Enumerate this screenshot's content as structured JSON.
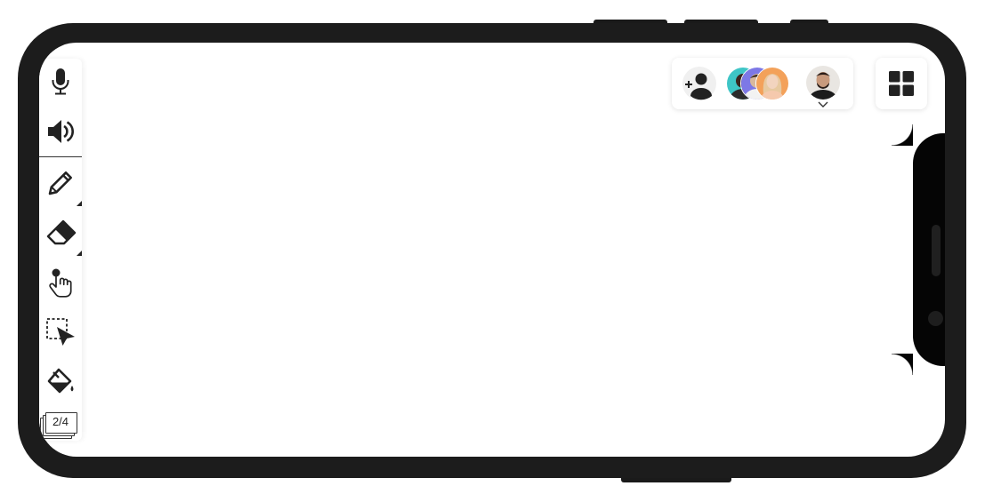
{
  "device": {
    "frame_color": "#1c1c1c",
    "screen_color": "#ffffff"
  },
  "toolbar": {
    "tools": [
      {
        "name": "microphone",
        "icon": "microphone-icon"
      },
      {
        "name": "speaker",
        "icon": "speaker-icon"
      },
      {
        "name": "pencil",
        "icon": "pencil-icon",
        "has_submenu": true
      },
      {
        "name": "eraser",
        "icon": "eraser-icon",
        "has_submenu": true
      },
      {
        "name": "hand",
        "icon": "hand-pointer-icon"
      },
      {
        "name": "select",
        "icon": "selection-arrow-icon"
      },
      {
        "name": "fill",
        "icon": "paint-bucket-icon"
      }
    ],
    "page_indicator": "2/4"
  },
  "participants": {
    "add_user_icon": "add-user-icon",
    "avatars": [
      {
        "name": "participant-1",
        "bg": "#3ec5c6"
      },
      {
        "name": "participant-2",
        "bg": "#7d78e6"
      },
      {
        "name": "participant-3",
        "bg": "#f3a15a"
      }
    ],
    "current_user": {
      "name": "current-user",
      "bg": "#e9e6e2"
    },
    "chevron_icon": "chevron-down-icon"
  },
  "grid_button": {
    "icon": "grid-icon"
  }
}
